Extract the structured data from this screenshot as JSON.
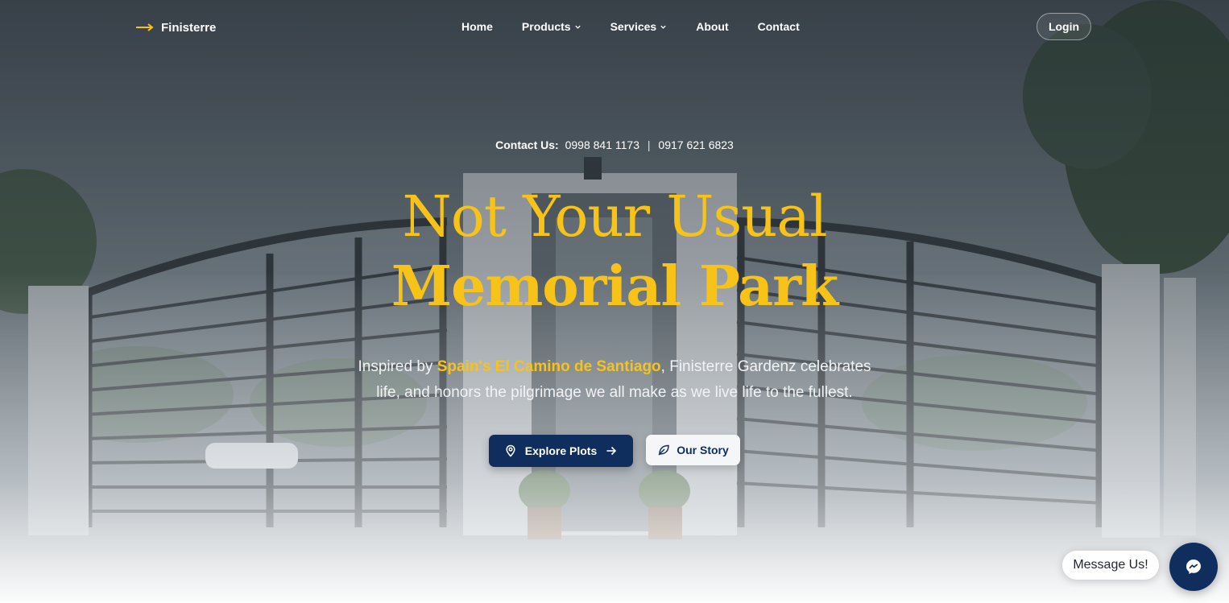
{
  "nav": {
    "brand": "Finisterre",
    "items": [
      {
        "label": "Home",
        "dropdown": false
      },
      {
        "label": "Products",
        "dropdown": true
      },
      {
        "label": "Services",
        "dropdown": true
      },
      {
        "label": "About",
        "dropdown": false
      },
      {
        "label": "Contact",
        "dropdown": false
      }
    ],
    "login_label": "Login"
  },
  "hero": {
    "contact_label": "Contact Us:",
    "phone_1": "0998 841 1173",
    "phone_separator": "|",
    "phone_2": "0917 621 6823",
    "headline_line1": "Not Your Usual",
    "headline_line2": "Memorial Park",
    "lede_prefix": "Inspired by ",
    "lede_highlight": "Spain's El Camino de Santiago",
    "lede_suffix": ", Finisterre Gardenz celebrates life, and honors the pilgrimage we all make as we live life to the fullest.",
    "primary_cta": "Explore Plots",
    "secondary_cta": "Our Story"
  },
  "chat": {
    "bubble_text": "Message Us!"
  },
  "colors": {
    "accent_gold": "#f7c318",
    "brand_navy": "#0f2e5e",
    "text_light": "#ffffff"
  },
  "icons": {
    "brand": "arrow-right-icon",
    "dropdown": "chevron-down-icon",
    "primary_cta_leading": "map-pin-icon",
    "primary_cta_trailing": "arrow-right-icon",
    "secondary_cta": "leaf-icon",
    "chat": "messenger-icon"
  }
}
